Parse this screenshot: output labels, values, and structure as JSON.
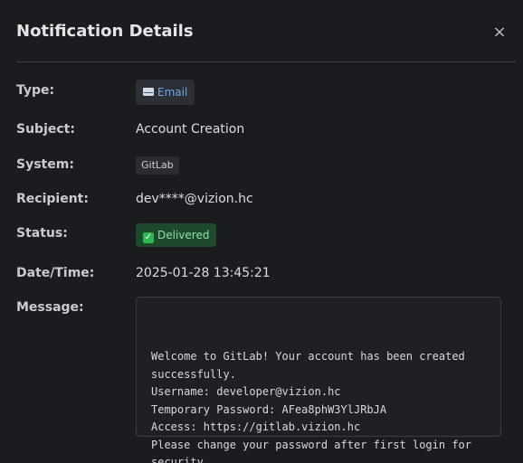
{
  "dialog": {
    "title": "Notification Details",
    "close_glyph": "×"
  },
  "fields": {
    "type_label": "Type:",
    "type_value": "Email",
    "type_icon": "email-icon",
    "subject_label": "Subject:",
    "subject_value": "Account Creation",
    "system_label": "System:",
    "system_value": "GitLab",
    "recipient_label": "Recipient:",
    "recipient_value": "dev****@vizion.hc",
    "status_label": "Status:",
    "status_value": "Delivered",
    "status_icon": "check-icon",
    "status_color": "#1d4a2c",
    "datetime_label": "Date/Time:",
    "datetime_value": "2025-01-28 13:45:21",
    "message_label": "Message:",
    "message_lines": [
      "Welcome to GitLab! Your account has been created",
      "successfully.",
      "Username: developer@vizion.hc",
      "Temporary Password: AFea8phW3YlJRbJA",
      "Access: https://gitlab.vizion.hc",
      "Please change your password after first login for",
      "security."
    ]
  },
  "colors": {
    "background": "#1b1c1f",
    "email_accent": "#6fa8e6",
    "delivered_text": "#8fe0a8"
  }
}
